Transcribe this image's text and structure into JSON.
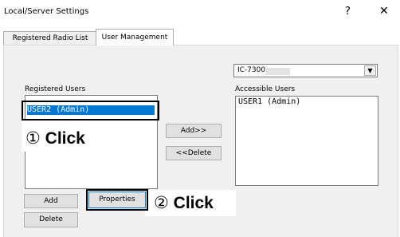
{
  "window": {
    "title": "Local/Server Settings",
    "help_glyph": "?",
    "close_glyph": "✕"
  },
  "tabs": [
    {
      "label": "Registered Radio List",
      "active": false
    },
    {
      "label": "User Management",
      "active": true
    }
  ],
  "radio_select": {
    "value": "IC-7300",
    "arrow": "▼"
  },
  "registered_users": {
    "label": "Registered Users",
    "items": [
      "USER2 (Admin)"
    ]
  },
  "accessible_users": {
    "label": "Accessible Users",
    "items": [
      "USER1 (Admin)"
    ]
  },
  "buttons": {
    "add_right": "Add>>",
    "delete_left": "<<Delete",
    "add": "Add",
    "properties": "Properties",
    "delete": "Delete"
  },
  "callouts": {
    "step1_num": "①",
    "step1_text": "Click",
    "step2_num": "②",
    "step2_text": "Click"
  }
}
